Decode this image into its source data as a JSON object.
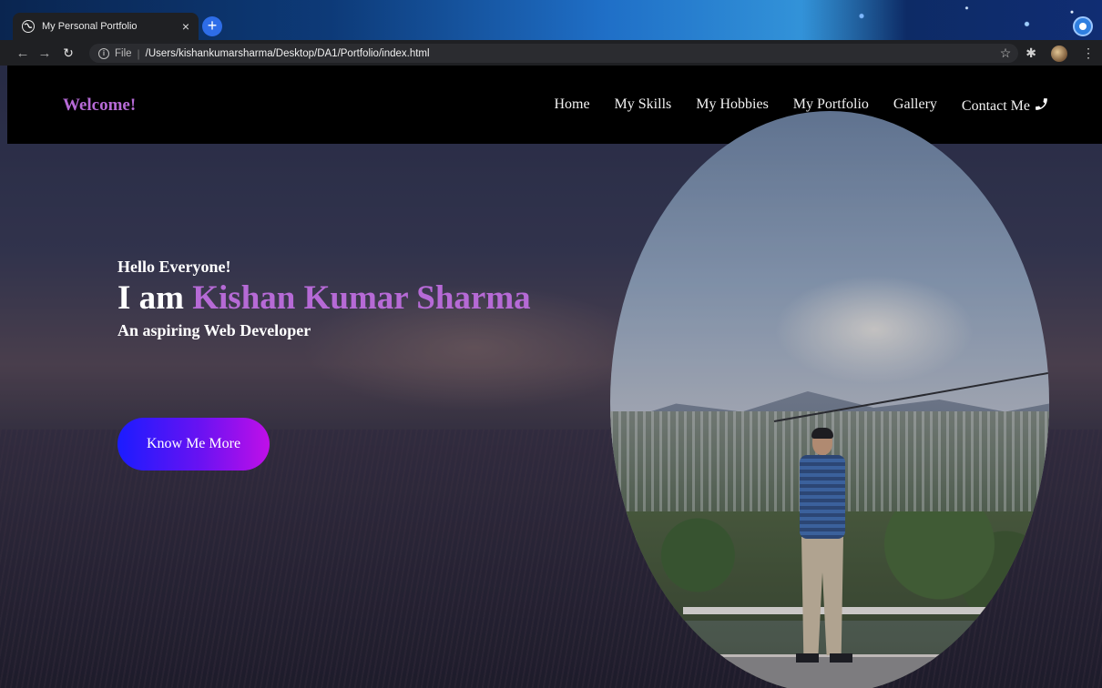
{
  "browser": {
    "tab_title": "My Personal Portfolio",
    "tab_close": "×",
    "new_tab": "+",
    "url_scheme": "File",
    "url_separator": "|",
    "url_path": "/Users/kishankumarsharma/Desktop/DA1/Portfolio/index.html",
    "nav_icons": [
      "back-arrow-icon",
      "forward-arrow-icon",
      "reload-icon",
      "info-icon"
    ],
    "toolbar_icons": [
      "star-icon",
      "extensions-icon",
      "profile-avatar-icon",
      "menu-dots-icon"
    ]
  },
  "navbar": {
    "brand": "Welcome!",
    "links": [
      "Home",
      "My Skills",
      "My Hobbies",
      "My Portfolio",
      "Gallery",
      "Contact Me"
    ],
    "contact_icon": "phone-icon"
  },
  "hero": {
    "greeting": "Hello Everyone!",
    "intro_prefix": "I am ",
    "name": "Kishan Kumar Sharma",
    "tagline": "An aspiring Web Developer",
    "cta_label": "Know Me More"
  },
  "colors": {
    "accent_purple": "#b66ad6",
    "cta_gradient_start": "#1b1cff",
    "cta_gradient_end": "#c00fe8",
    "navbar_bg": "#000000"
  }
}
